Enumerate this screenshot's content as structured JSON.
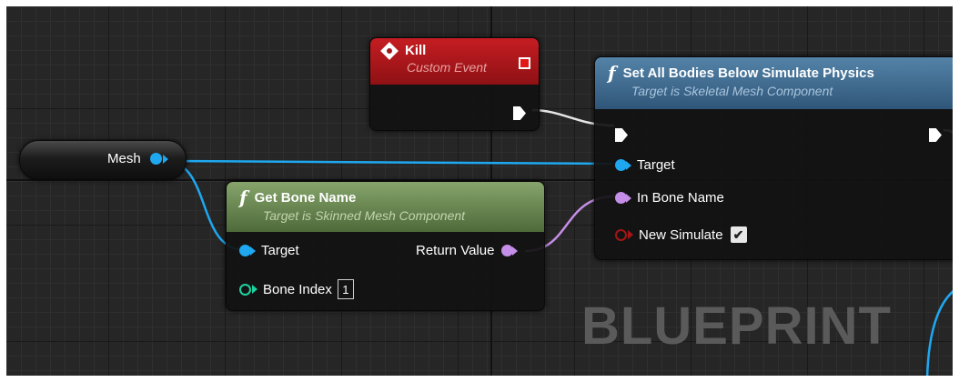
{
  "watermark": "BLUEPRINT",
  "mesh_node": {
    "label": "Mesh"
  },
  "kill_node": {
    "title": "Kill",
    "subtitle": "Custom Event"
  },
  "set_bodies_node": {
    "title": "Set All Bodies Below Simulate Physics",
    "subtitle": "Target is Skeletal Mesh Component",
    "pins": {
      "target": "Target",
      "in_bone_name": "In Bone Name",
      "new_simulate": "New Simulate"
    },
    "new_simulate_checked": true
  },
  "get_bone_node": {
    "title": "Get Bone Name",
    "subtitle": "Target is Skinned Mesh Component",
    "pins": {
      "target": "Target",
      "bone_index": "Bone Index",
      "return_value": "Return Value"
    },
    "bone_index_value": "1"
  },
  "colors": {
    "object_pin": "#1fa8f0",
    "name_pin": "#c58ee8",
    "int_pin": "#1ed1a0",
    "bool_pin": "#a51515",
    "event_header": "#a3171b",
    "function_header": "#3e6c8f",
    "pure_function_header": "#6f8f56"
  }
}
